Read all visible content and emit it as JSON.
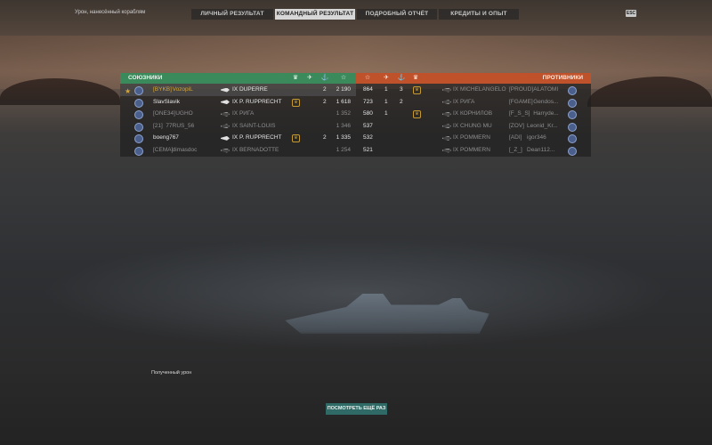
{
  "top_label": "Урон, нанесённый кораблям",
  "esc_label": "ESC",
  "tabs": [
    {
      "label": "ЛИЧНЫЙ РЕЗУЛЬТАТ",
      "active": false
    },
    {
      "label": "КОМАНДНЫЙ РЕЗУЛЬТАТ",
      "active": true
    },
    {
      "label": "ПОДРОБНЫЙ ОТЧЁТ",
      "active": false
    },
    {
      "label": "КРЕДИТЫ И ОПЫТ",
      "active": false
    }
  ],
  "allies": {
    "title": "СОЮЗНИКИ",
    "columns": [
      "medal-icon",
      "planes-icon",
      "frags-icon",
      "star-icon"
    ],
    "rows": [
      {
        "clan": "[BYKB]",
        "name": "VozopiL",
        "ship": "IX DUPERRE",
        "frags": "2",
        "damage": "2 190",
        "rank": "★",
        "highlight": true,
        "medal": false,
        "dim": false,
        "ship_icon": "solid"
      },
      {
        "clan": "",
        "name": "SlavSlavik",
        "ship": "IX P. RUPPRECHT",
        "frags": "2",
        "damage": "1 618",
        "rank": "II",
        "highlight": false,
        "medal": true,
        "dim": false,
        "ship_icon": "solid"
      },
      {
        "clan": "[ONE34]",
        "name": "UGHO",
        "ship": "IX РИГА",
        "frags": "",
        "damage": "1 352",
        "rank": "II",
        "highlight": false,
        "medal": false,
        "dim": true,
        "ship_icon": "outline"
      },
      {
        "clan": "[21]",
        "name": "77RUS_56",
        "ship": "IX SAINT-LOUIS",
        "frags": "",
        "damage": "1 346",
        "rank": "II",
        "highlight": false,
        "medal": false,
        "dim": true,
        "ship_icon": "outline"
      },
      {
        "clan": "",
        "name": "boeng767",
        "ship": "IX P. RUPPRECHT",
        "frags": "2",
        "damage": "1 335",
        "rank": "II",
        "highlight": false,
        "medal": true,
        "dim": false,
        "ship_icon": "solid"
      },
      {
        "clan": "[CEMA]",
        "name": "dimasdoc",
        "ship": "IX BERNADOTTE",
        "frags": "",
        "damage": "1 254",
        "rank": "II",
        "highlight": false,
        "medal": false,
        "dim": true,
        "ship_icon": "outline"
      }
    ]
  },
  "enemies": {
    "title": "ПРОТИВНИКИ",
    "columns": [
      "star-icon",
      "planes-icon",
      "frags-icon",
      "medal-icon"
    ],
    "rows": [
      {
        "damage": "864",
        "planes": "1",
        "frags": "3",
        "medal": true,
        "ship": "IX MICHELANGELO",
        "clan": "[PROUD]",
        "name": "ALATOMI",
        "rank": "II"
      },
      {
        "damage": "723",
        "planes": "1",
        "frags": "2",
        "medal": false,
        "ship": "IX РИГА",
        "clan": "[FGAME]",
        "name": "Gendos...",
        "rank": "II"
      },
      {
        "damage": "580",
        "planes": "1",
        "frags": "",
        "medal": true,
        "ship": "IX КОРНИЛОВ",
        "clan": "[F_S_S]",
        "name": "Harryde...",
        "rank": "II"
      },
      {
        "damage": "537",
        "planes": "",
        "frags": "",
        "medal": false,
        "ship": "IX CHUNG MU",
        "clan": "[ZOV]",
        "name": "Leonid_Kr...",
        "rank": "II"
      },
      {
        "damage": "532",
        "planes": "",
        "frags": "",
        "medal": false,
        "ship": "IX POMMERN",
        "clan": "[ADI]",
        "name": "igor346",
        "rank": "II"
      },
      {
        "damage": "521",
        "planes": "",
        "frags": "",
        "medal": false,
        "ship": "IX POMMERN",
        "clan": "[_Z_]",
        "name": "Dean112...",
        "rank": "II"
      }
    ]
  },
  "received_damage_label": "Полученный урон",
  "replay_button": "ПОСМОТРЕТЬ ЕЩЁ РАЗ",
  "colors": {
    "allies": "#3a8a5c",
    "enemies": "#c0522b",
    "button": "#2f6a66",
    "gold": "#d3a43b"
  }
}
